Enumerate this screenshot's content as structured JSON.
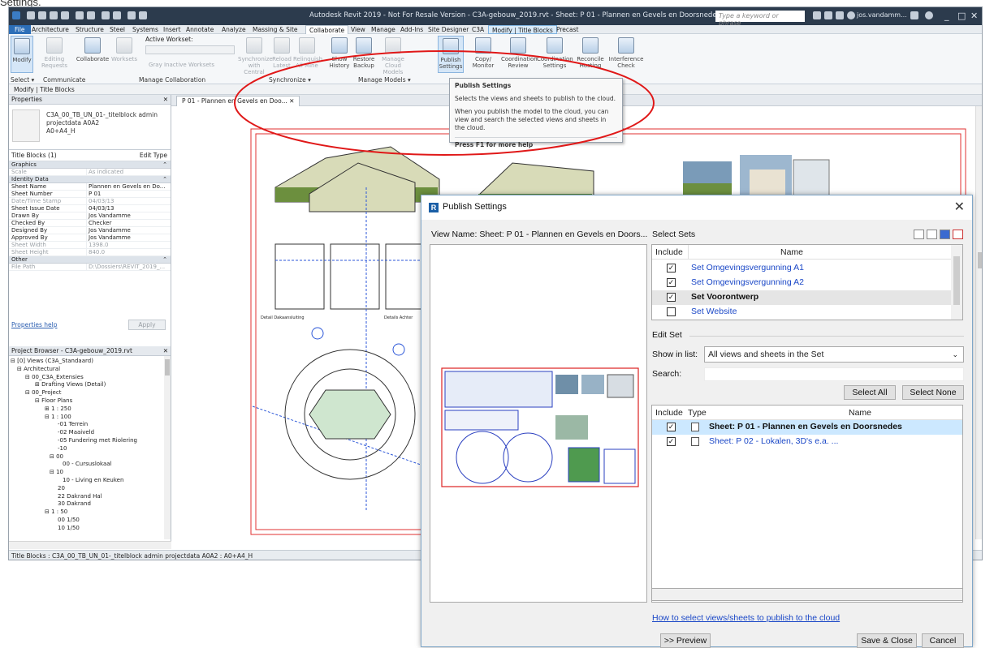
{
  "top_caption": "Settings.",
  "window": {
    "title": "Autodesk Revit 2019 - Not For Resale Version - C3A-gebouw_2019.rvt - Sheet: P 01 - Plannen en Gevels en Doorsnedes",
    "search_placeholder": "Type a keyword or phrase",
    "user": "jos.vandamm...",
    "min": "_",
    "restore": "□",
    "close": "✕"
  },
  "menu": [
    "File",
    "Architecture",
    "Structure",
    "Steel",
    "Systems",
    "Insert",
    "Annotate",
    "Analyze",
    "Massing & Site",
    "Collaborate",
    "View",
    "Manage",
    "Add-Ins",
    "Site Designer",
    "C3A",
    "Modify | Title Blocks",
    "Precast"
  ],
  "ribbon": {
    "modify": "Modify",
    "editing": "Editing Requests",
    "collaborate": "Collaborate",
    "worksets": "Worksets",
    "active_workset": "Active Workset:",
    "gray": "Gray Inactive Worksets",
    "sync": "Synchronize with Central",
    "reload": "Reload Latest",
    "relinquish": "Relinquish All Mine",
    "show_history": "Show History",
    "restore_backup": "Restore Backup",
    "manage_cloud": "Manage Cloud Models",
    "publish": "Publish Settings",
    "copy_monitor": "Copy/ Monitor",
    "coord_review": "Coordination Review",
    "coord_settings": "Coordination Settings",
    "reconcile": "Reconcile Hosting",
    "interference": "Interference Check",
    "panel_select": "Select ▾",
    "panel_communicate": "Communicate",
    "panel_manage_collab": "Manage Collaboration",
    "panel_sync": "Synchronize ▾",
    "panel_manage_models": "Manage Models ▾"
  },
  "context_label": "Modify | Title Blocks",
  "tooltip": {
    "title": "Publish Settings",
    "line1": "Selects the views and sheets to publish to the cloud.",
    "line2": "When you publish the model to the cloud, you can view and search the selected views and sheets in the cloud.",
    "help": "Press F1 for more help"
  },
  "properties": {
    "header": "Properties",
    "close": "✕",
    "type_name": "C3A_00_TB_UN_01-_titelblock admin\nprojectdata A0A2\nA0+A4_H",
    "filter": "Title Blocks (1)",
    "edit_type": "Edit Type",
    "groups": {
      "graphics": "Graphics",
      "identity": "Identity Data",
      "other": "Other"
    },
    "rows": [
      {
        "k": "Scale",
        "v": "As indicated"
      },
      {
        "k": "Sheet Name",
        "v": "Plannen en Gevels en Do..."
      },
      {
        "k": "Sheet Number",
        "v": "P 01"
      },
      {
        "k": "Date/Time Stamp",
        "v": "04/03/13"
      },
      {
        "k": "Sheet Issue Date",
        "v": "04/03/13"
      },
      {
        "k": "Drawn By",
        "v": "Jos Vandamme"
      },
      {
        "k": "Checked By",
        "v": "Checker"
      },
      {
        "k": "Designed By",
        "v": "Jos Vandamme"
      },
      {
        "k": "Approved By",
        "v": "Jos Vandamme"
      },
      {
        "k": "Sheet Width",
        "v": "1398.0"
      },
      {
        "k": "Sheet Height",
        "v": "840.0"
      },
      {
        "k": "File Path",
        "v": "D:\\Dossiers\\REVIT_2019_..."
      }
    ],
    "help": "Properties help",
    "apply": "Apply"
  },
  "browser": {
    "header": "Project Browser - C3A-gebouw_2019.rvt",
    "close": "✕",
    "items": [
      "⊟ [0] Views (C3A_Standaard)",
      "⊟ Architectural",
      "⊟ 00_C3A_Extensies",
      "⊞ Drafting Views (Detail)",
      "⊟ 00_Project",
      "⊟ Floor Plans",
      "⊞ 1 : 250",
      "⊟ 1 : 100",
      "-01 Terrein",
      "-02 Maaiveld",
      "-05 Fundering met Riolering",
      "-10",
      "⊟ 00",
      "00 - Cursuslokaal",
      "⊟ 10",
      "10 - Living en Keuken",
      "20",
      "22 Dakrand Hal",
      "30 Dakrand",
      "⊟ 1 : 50",
      "00 1/50",
      "10 1/50"
    ]
  },
  "view_tab": "P 01 - Plannen en Gevels en Doo...",
  "view_tab_close": "✕",
  "status": "Title Blocks : C3A_00_TB_UN_01-_titelblock admin projectdata A0A2 : A0+A4_H",
  "drawing_labels": {
    "left": "Detail Dakaansluiting",
    "right": "Details Achter"
  },
  "dialog": {
    "title": "Publish Settings",
    "close": "✕",
    "view_name": "View Name: Sheet: P 01 - Plannen en Gevels en Doors...",
    "select_sets": "Select Sets",
    "col_include": "Include",
    "col_name": "Name",
    "sets": [
      {
        "name": "Set Omgevingsvergunning A1",
        "checked": true,
        "bold": false
      },
      {
        "name": "Set Omgevingsvergunning A2",
        "checked": true,
        "bold": false
      },
      {
        "name": "Set Voorontwerp",
        "checked": true,
        "bold": true
      },
      {
        "name": "Set Website",
        "checked": false,
        "bold": false
      }
    ],
    "edit_set": "Edit Set",
    "show_in_list": "Show in list:",
    "show_value": "All views and sheets in the Set",
    "search": "Search:",
    "search_value": "",
    "select_all": "Select All",
    "select_none": "Select None",
    "col_type": "Type",
    "views": [
      {
        "name": "Sheet: P 01 - Plannen en Gevels en Doorsnedes",
        "checked": true,
        "bold": true
      },
      {
        "name": "Sheet: P 02 - Lokalen, 3D's e.a. ...",
        "checked": true,
        "bold": false
      }
    ],
    "help_link": "How to select views/sheets to publish to the cloud",
    "preview_btn": ">> Preview",
    "save_close": "Save & Close",
    "cancel": "Cancel"
  },
  "colors": {
    "annotation": "#e01818",
    "title_bar": "#2c3b4d",
    "file_tab": "#2d6fb8",
    "link": "#1a47c7"
  }
}
